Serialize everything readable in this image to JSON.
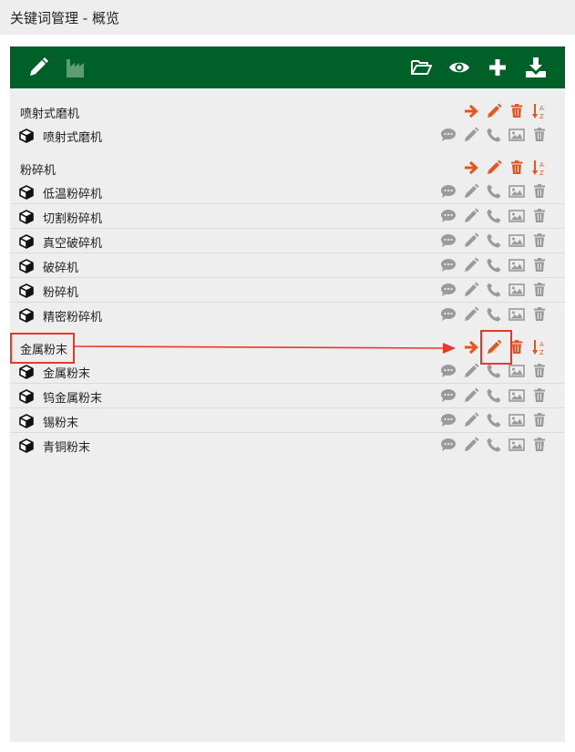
{
  "window": {
    "title": "关键词管理 - 概览"
  },
  "toolbar": {
    "left_icons": [
      "pencil-icon",
      "factory-icon"
    ],
    "right_icons": [
      "folder-open-icon",
      "eye-icon",
      "plus-icon",
      "download-icon"
    ]
  },
  "colors": {
    "toolbar_bg": "#006128",
    "group_action": "#e8541e",
    "item_action": "#9a9a9a",
    "annotation": "#e8382b"
  },
  "groups": [
    {
      "name": "喷射式磨机",
      "items": [
        "喷射式磨机"
      ]
    },
    {
      "name": "粉碎机",
      "items": [
        "低温粉碎机",
        "切割粉碎机",
        "真空破碎机",
        "破碎机",
        "粉碎机",
        "精密粉碎机"
      ]
    },
    {
      "name": "金属粉末",
      "items": [
        "金属粉末",
        "钨金属粉末",
        "锡粉末",
        "青铜粉末"
      ]
    }
  ],
  "group_actions": [
    "arrow-right-icon",
    "pencil-icon",
    "trash-icon",
    "sort-az-icon"
  ],
  "item_actions": [
    "comment-icon",
    "pencil-icon",
    "phone-icon",
    "image-icon",
    "trash-icon"
  ]
}
